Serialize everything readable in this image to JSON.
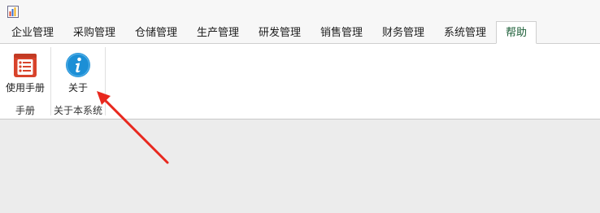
{
  "app": {
    "logo_icon": "app-logo-icon"
  },
  "tabs": [
    {
      "label": "企业管理",
      "active": false
    },
    {
      "label": "采购管理",
      "active": false
    },
    {
      "label": "仓储管理",
      "active": false
    },
    {
      "label": "生产管理",
      "active": false
    },
    {
      "label": "研发管理",
      "active": false
    },
    {
      "label": "销售管理",
      "active": false
    },
    {
      "label": "财务管理",
      "active": false
    },
    {
      "label": "系统管理",
      "active": false
    },
    {
      "label": "帮助",
      "active": true
    }
  ],
  "ribbon": {
    "groups": [
      {
        "caption": "手册",
        "buttons": [
          {
            "label": "使用手册",
            "icon": "manual-icon"
          }
        ]
      },
      {
        "caption": "关于本系统",
        "buttons": [
          {
            "label": "关于",
            "icon": "info-icon"
          }
        ]
      }
    ]
  },
  "annotation": {
    "arrow_color": "#e8281e",
    "points_to": "about-button"
  },
  "colors": {
    "active_tab_text": "#1a5d36",
    "info_blue": "#1c8fd6",
    "manual_red": "#d8432b"
  }
}
